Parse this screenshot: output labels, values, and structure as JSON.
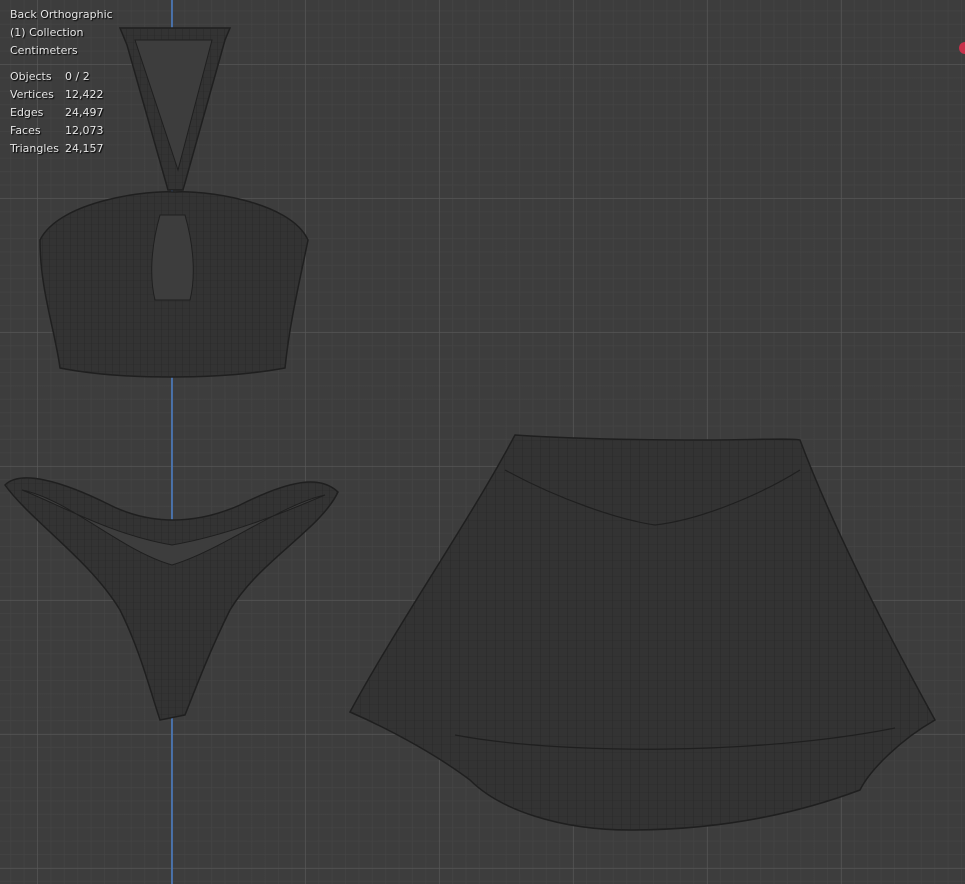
{
  "viewport": {
    "view_name": "Back Orthographic",
    "collection": "(1) Collection",
    "units": "Centimeters"
  },
  "stats": [
    {
      "label": "Objects",
      "value": "0 / 2"
    },
    {
      "label": "Vertices",
      "value": "12,422"
    },
    {
      "label": "Edges",
      "value": "24,497"
    },
    {
      "label": "Faces",
      "value": "12,073"
    },
    {
      "label": "Triangles",
      "value": "24,157"
    }
  ],
  "colors": {
    "background": "#3d3d3d",
    "axis": "#4a78b8",
    "gizmo": "#c8304a"
  }
}
